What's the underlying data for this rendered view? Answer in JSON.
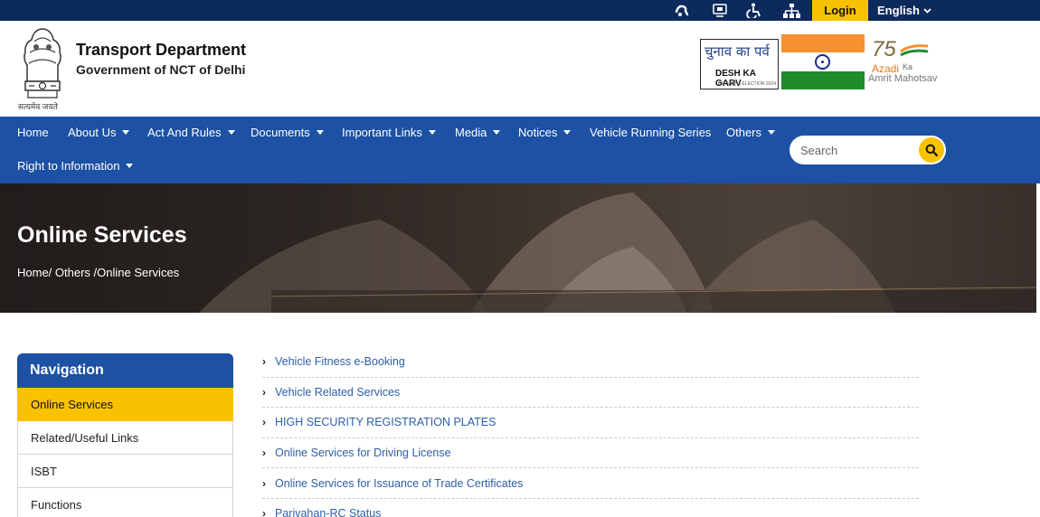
{
  "topbar": {
    "login_label": "Login",
    "language_label": "English"
  },
  "header": {
    "emblem_caption": "सत्यमेव जयते",
    "title": "Transport Department",
    "subtitle": "Government of NCT of Delhi",
    "election_logo": {
      "hindi_text": "चुनाव का पर्व",
      "english_text": "DESH KA GARV",
      "small_text": "LOK SABHA ELECTION 2024"
    },
    "azadi_logo": {
      "number": "75",
      "line1": "Azadi",
      "line1_suffix": "Ka",
      "line2": "Amrit Mahotsav"
    }
  },
  "nav": {
    "items": [
      {
        "label": "Home",
        "dropdown": false
      },
      {
        "label": "About Us",
        "dropdown": true
      },
      {
        "label": "Act And Rules",
        "dropdown": true
      },
      {
        "label": "Documents",
        "dropdown": true
      },
      {
        "label": "Important Links",
        "dropdown": true
      },
      {
        "label": "Media",
        "dropdown": true
      },
      {
        "label": "Notices",
        "dropdown": true
      },
      {
        "label": "Vehicle Running Series",
        "dropdown": false
      },
      {
        "label": "Others",
        "dropdown": true
      },
      {
        "label": "Right to Information",
        "dropdown": true
      }
    ],
    "search_placeholder": "Search"
  },
  "banner": {
    "title": "Online Services",
    "breadcrumb": "Home/ Others /Online Services"
  },
  "sidebar": {
    "heading": "Navigation",
    "items": [
      {
        "label": "Online Services",
        "active": true
      },
      {
        "label": "Related/Useful Links",
        "active": false
      },
      {
        "label": "ISBT",
        "active": false
      },
      {
        "label": "Functions",
        "active": false
      }
    ]
  },
  "content": {
    "links": [
      "Vehicle Fitness e-Booking",
      "Vehicle Related Services",
      "HIGH SECURITY REGISTRATION PLATES",
      "Online Services for Driving License",
      "Online Services for Issuance of Trade Certificates",
      "Parivahan-RC Status"
    ]
  },
  "colors": {
    "topbar": "#0d2a5c",
    "nav": "#1c51a3",
    "accent": "#f8c200",
    "link": "#2e5fa8"
  }
}
